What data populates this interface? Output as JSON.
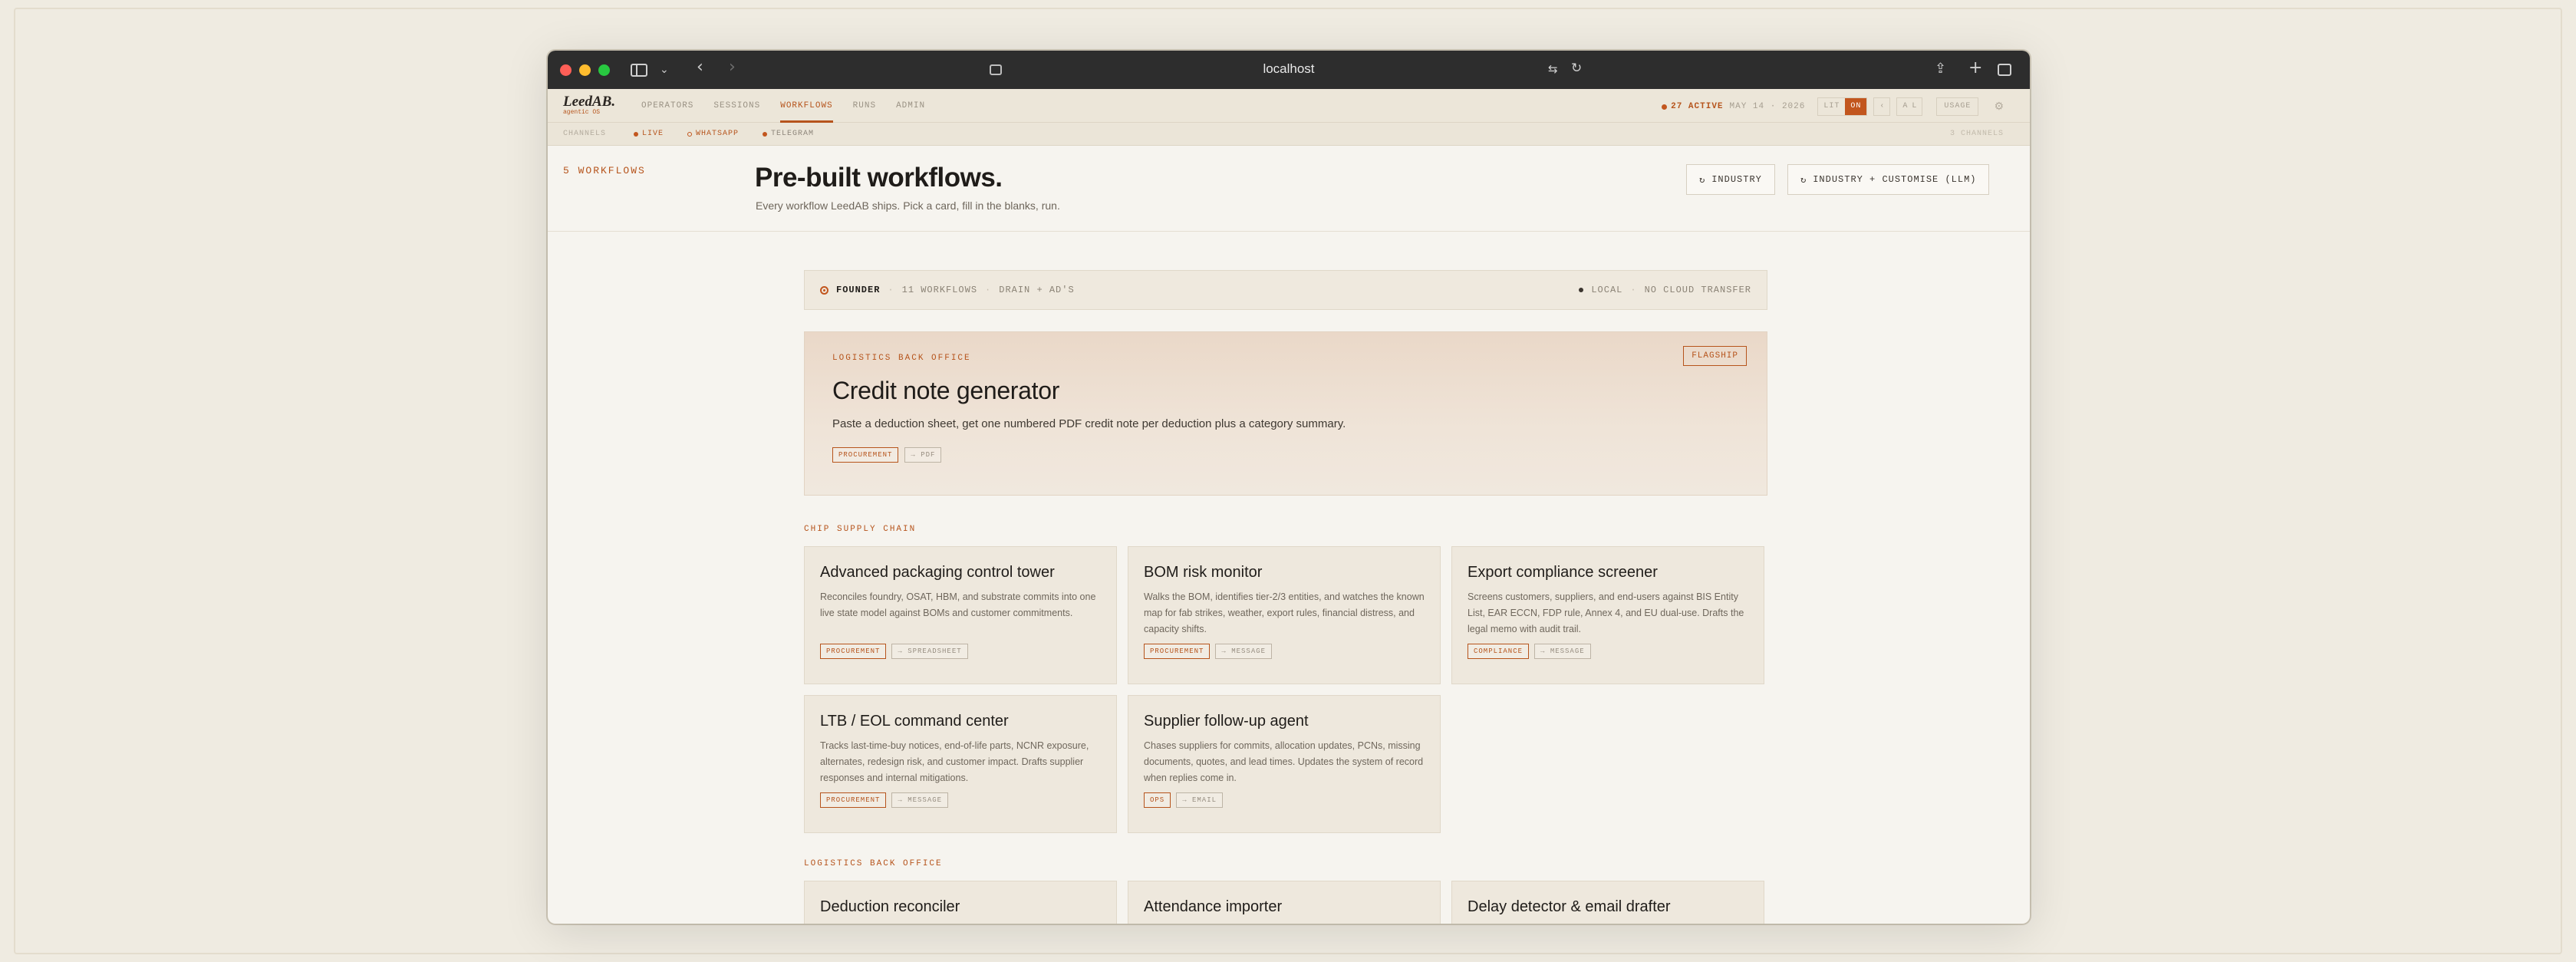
{
  "browser": {
    "url": "localhost"
  },
  "nav": {
    "brand": "LeedAB.",
    "brand_sub": "agentic OS",
    "links": [
      "OPERATORS",
      "SESSIONS",
      "WORKFLOWS",
      "RUNS",
      "ADMIN"
    ],
    "active_link": "WORKFLOWS",
    "active_count": "27 ACTIVE",
    "date": "MAY 14 · 2026",
    "view_toggle": [
      "LIT",
      "ON"
    ],
    "font_btn": "A L",
    "back_btn": "‹",
    "usage": "USAGE"
  },
  "channels": {
    "label": "CHANNELS",
    "items": [
      {
        "name": "LIVE",
        "color": "#c2561e"
      },
      {
        "name": "WHATSAPP",
        "color": "#c2561e"
      },
      {
        "name": "TELEGRAM",
        "color": "#c2561e"
      }
    ],
    "count": "3 CHANNELS"
  },
  "page": {
    "count_label": "5 WORKFLOWS",
    "title": "Pre-built workflows.",
    "subtitle": "Every workflow LeedAB ships. Pick a card, fill in the blanks, run.",
    "btn_industry": "INDUSTRY",
    "btn_customise": "INDUSTRY + CUSTOMISE (LLM)"
  },
  "founder": {
    "name": "FOUNDER",
    "workflows": "11 WORKFLOWS",
    "owner": "DRAIN + AD'S",
    "local": "LOCAL",
    "cloud": "NO CLOUD TRANSFER"
  },
  "flagship": {
    "kicker": "LOGISTICS BACK OFFICE",
    "title": "Credit note generator",
    "desc": "Paste a deduction sheet, get one numbered PDF credit note per deduction plus a category summary.",
    "tag": "PROCUREMENT",
    "output": "→ PDF",
    "badge": "FLAGSHIP"
  },
  "sections": [
    {
      "label": "CHIP SUPPLY CHAIN",
      "cards": [
        {
          "title": "Advanced packaging control tower",
          "desc": "Reconciles foundry, OSAT, HBM, and substrate commits into one live state model against BOMs and customer commitments.",
          "tag": "PROCUREMENT",
          "output": "→ SPREADSHEET"
        },
        {
          "title": "BOM risk monitor",
          "desc": "Walks the BOM, identifies tier-2/3 entities, and watches the known map for fab strikes, weather, export rules, financial distress, and capacity shifts.",
          "tag": "PROCUREMENT",
          "output": "→ MESSAGE"
        },
        {
          "title": "Export compliance screener",
          "desc": "Screens customers, suppliers, and end-users against BIS Entity List, EAR ECCN, FDP rule, Annex 4, and EU dual-use. Drafts the legal memo with audit trail.",
          "tag": "COMPLIANCE",
          "output": "→ MESSAGE"
        },
        {
          "title": "LTB / EOL command center",
          "desc": "Tracks last-time-buy notices, end-of-life parts, NCNR exposure, alternates, redesign risk, and customer impact. Drafts supplier responses and internal mitigations.",
          "tag": "PROCUREMENT",
          "output": "→ MESSAGE"
        },
        {
          "title": "Supplier follow-up agent",
          "desc": "Chases suppliers for commits, allocation updates, PCNs, missing documents, quotes, and lead times. Updates the system of record when replies come in.",
          "tag": "OPS",
          "output": "→ EMAIL"
        }
      ]
    },
    {
      "label": "LOGISTICS BACK OFFICE",
      "cards": [
        {
          "title": "Deduction reconciler"
        },
        {
          "title": "Attendance importer"
        },
        {
          "title": "Delay detector & email drafter"
        }
      ]
    }
  ]
}
